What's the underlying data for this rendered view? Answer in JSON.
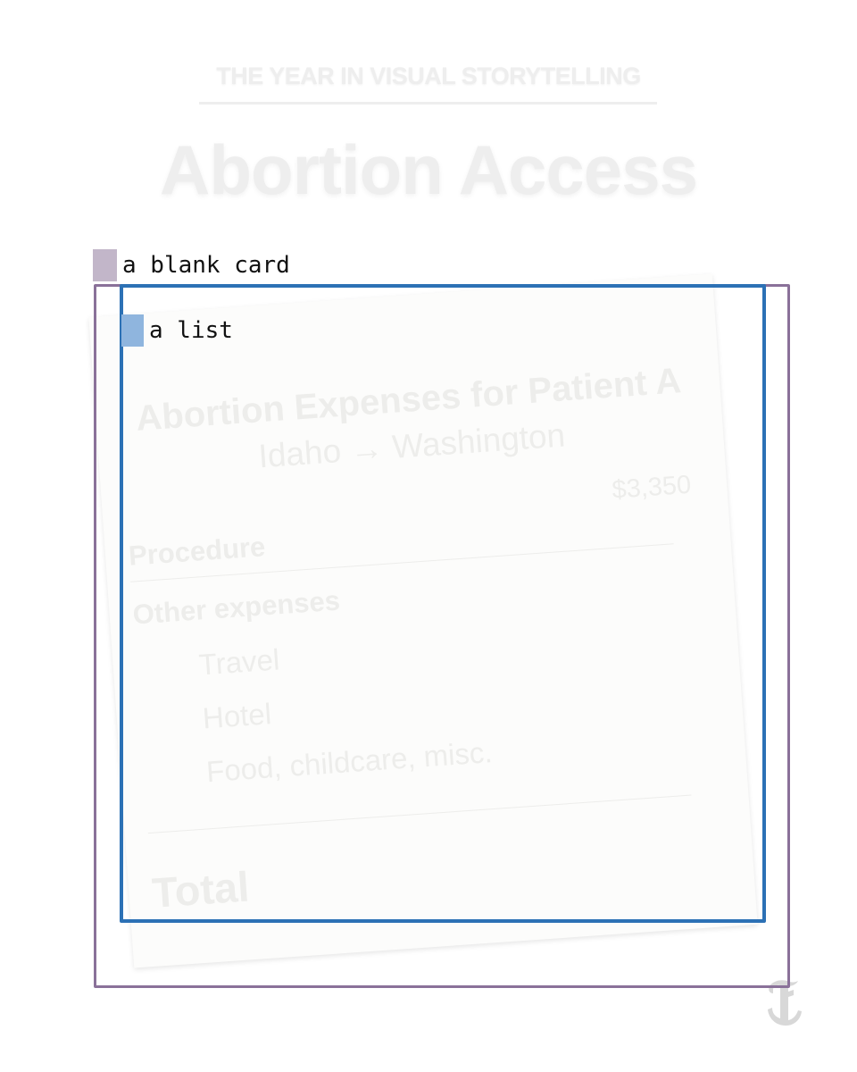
{
  "header": {
    "kicker": "THE YEAR IN VISUAL STORYTELLING",
    "headline": "Abortion Access"
  },
  "annotations": {
    "card_label": "a blank card",
    "list_label": "a list",
    "card_color": "#8a7199",
    "card_swatch_color": "#c2b6c9",
    "list_color": "#2c71b5",
    "list_swatch_color": "#8fb5de"
  },
  "receipt": {
    "title": "Abortion Expenses for Patient A",
    "route": "Idaho → Washington",
    "procedure_price": "$3,350",
    "procedure_label": "Procedure",
    "other_label": "Other expenses",
    "items": [
      "Travel",
      "Hotel",
      "Food, childcare, misc."
    ],
    "total_label": "Total"
  },
  "logo": {
    "icon": "nyt-t-logo-icon",
    "text": "T"
  }
}
